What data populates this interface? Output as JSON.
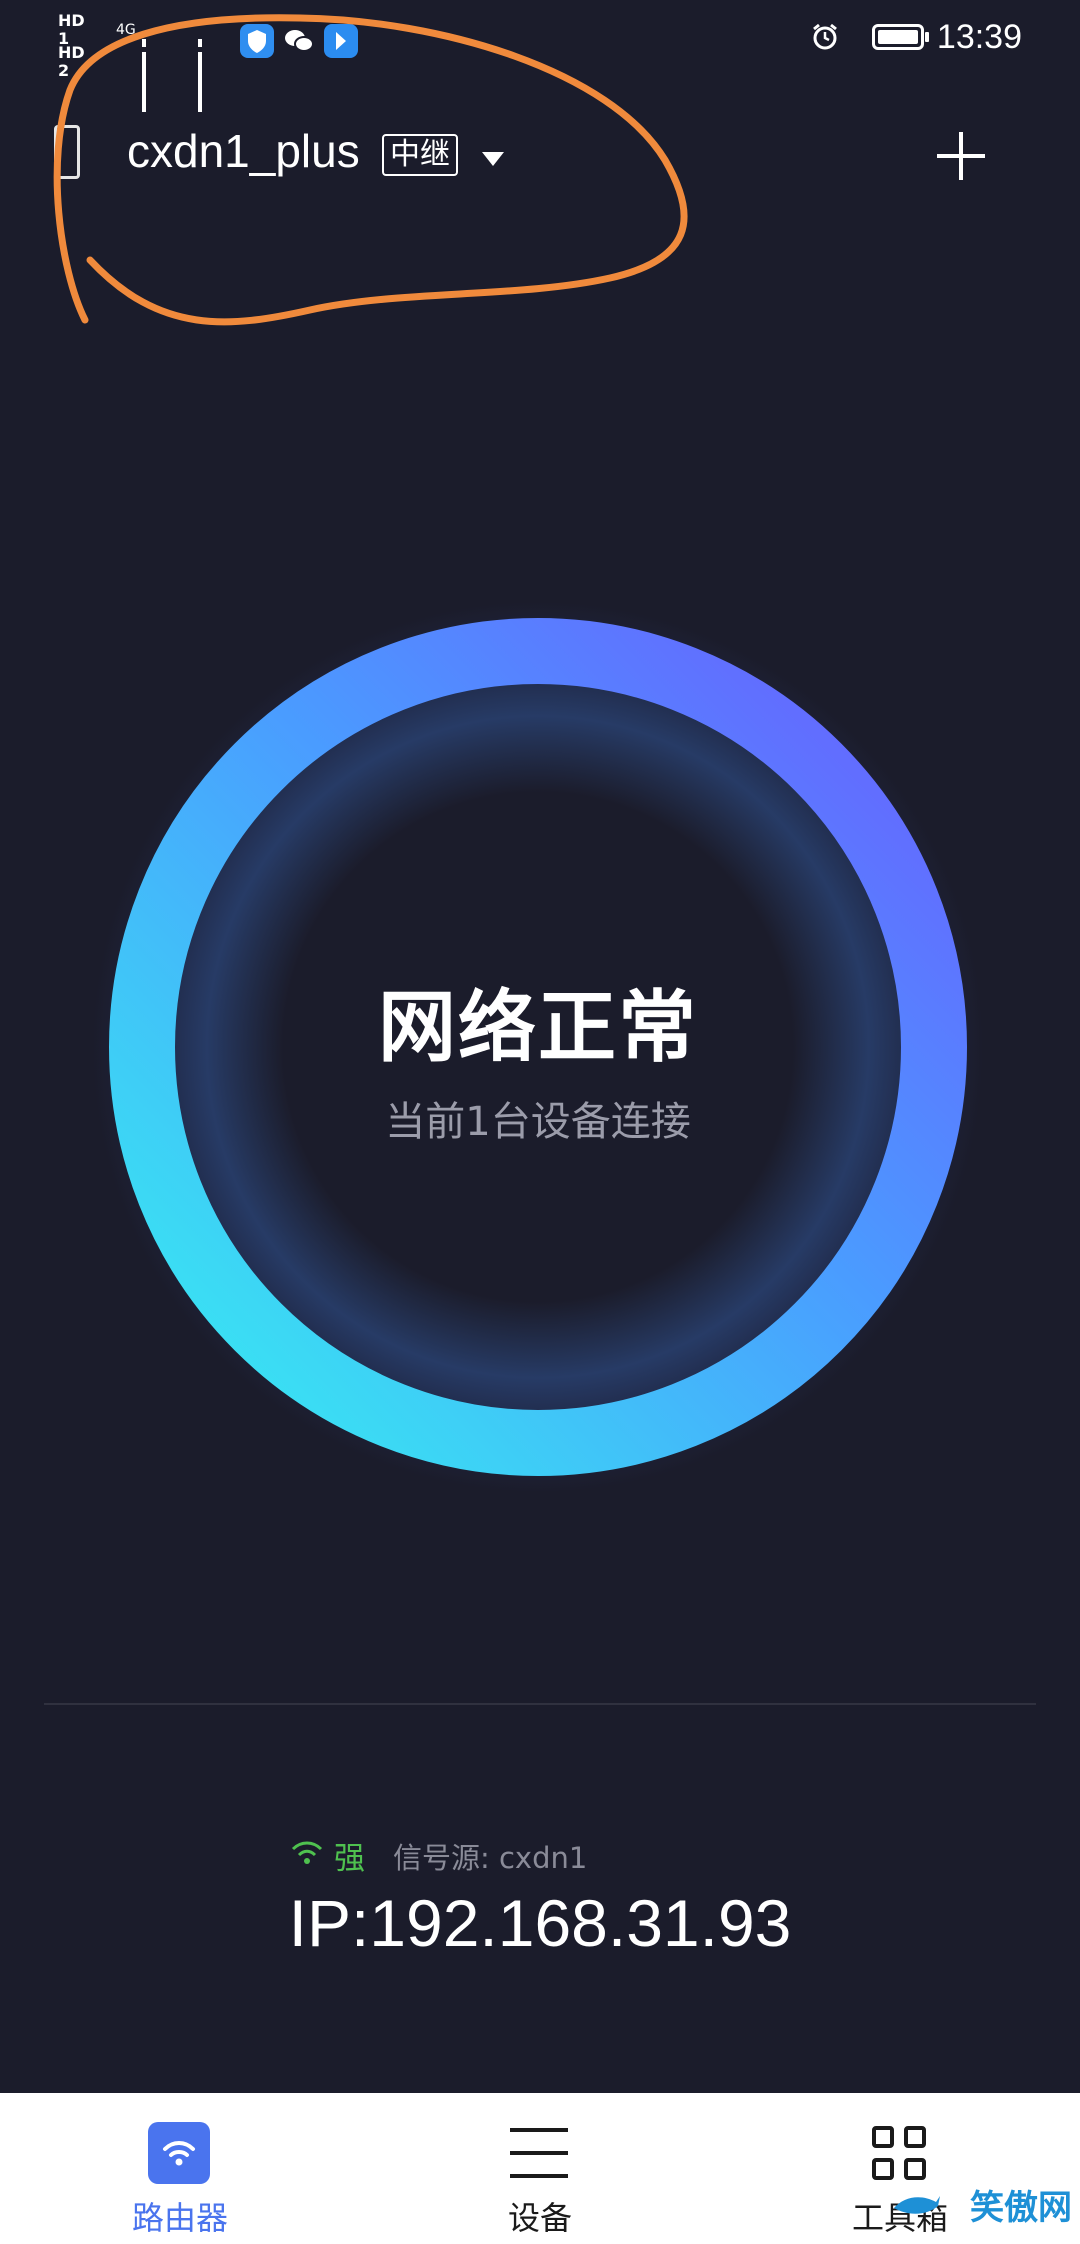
{
  "status_bar": {
    "hd1": "HD 1",
    "hd2": "HD 2",
    "network_type": "4G",
    "time": "13:39",
    "icons": [
      "signal-bars-icon",
      "shield-app-icon",
      "wechat-icon",
      "app-notification-icon",
      "alarm-clock-icon",
      "battery-icon"
    ]
  },
  "header": {
    "router_name": "cxdn1_plus",
    "mode_badge": "中继",
    "icons": [
      "phone-icon",
      "dropdown-arrow-icon",
      "add-icon"
    ]
  },
  "status": {
    "title": "网络正常",
    "subtitle": "当前1台设备连接"
  },
  "connection": {
    "strength": "强",
    "source": "信号源: cxdn1",
    "ip": "IP:192.168.31.93"
  },
  "bottom_nav": {
    "items": [
      {
        "label": "路由器",
        "icon": "wifi-icon",
        "active": true
      },
      {
        "label": "设备",
        "icon": "list-icon",
        "active": false
      },
      {
        "label": "工具箱",
        "icon": "grid-icon",
        "active": false
      }
    ]
  },
  "watermark": {
    "text": "笑傲网"
  },
  "colors": {
    "background": "#1b1c2b",
    "accent": "#4a74ee",
    "ring_start": "#36f0f0",
    "ring_end": "#6a5cff",
    "signal_good": "#4fc14f",
    "annotation": "#f08a3c"
  }
}
